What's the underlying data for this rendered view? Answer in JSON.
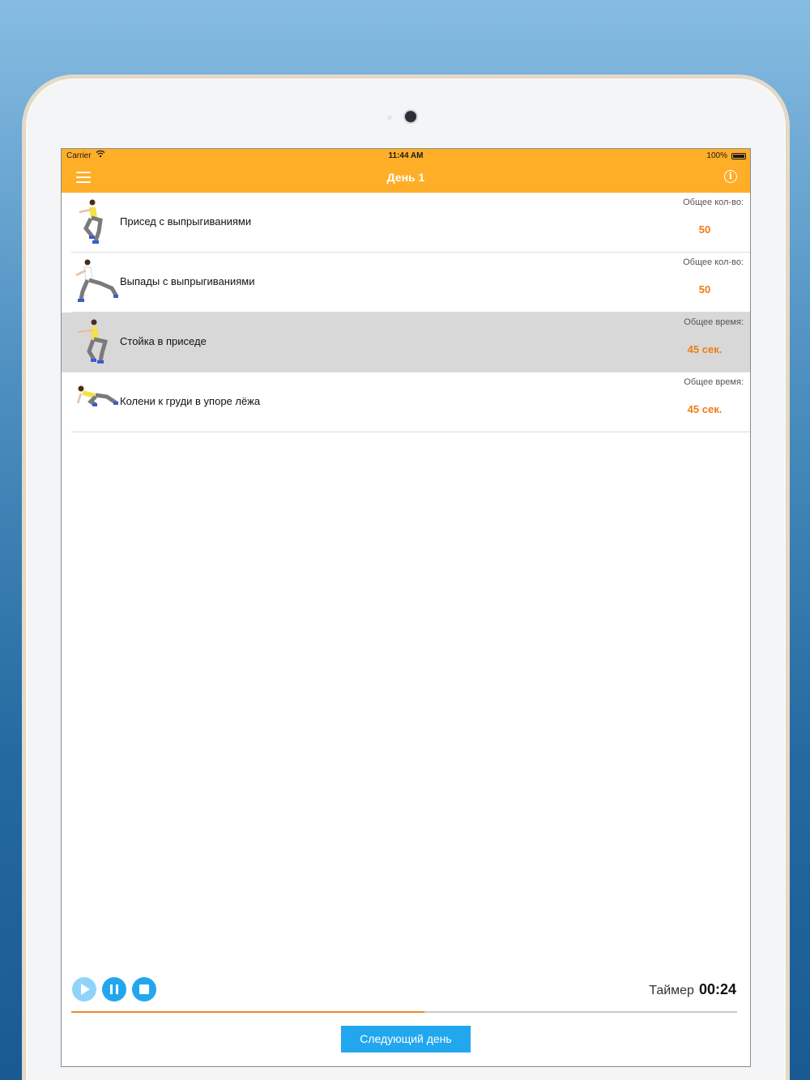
{
  "status_bar": {
    "carrier": "Carrier",
    "time": "11:44 AM",
    "battery": "100%"
  },
  "nav": {
    "title": "День 1"
  },
  "exercises": [
    {
      "name": "Присед с выпрыгиваниями",
      "label": "Общее кол-во:",
      "value": "50",
      "selected": false,
      "pose": "squat-jump"
    },
    {
      "name": "Выпады с выпрыгиваниями",
      "label": "Общее кол-во:",
      "value": "50",
      "selected": false,
      "pose": "lunge"
    },
    {
      "name": "Стойка в приседе",
      "label": "Общее время:",
      "value": "45 сек.",
      "selected": true,
      "pose": "squat-hold"
    },
    {
      "name": "Колени к груди в упоре лёжа",
      "label": "Общее время:",
      "value": "45 сек.",
      "selected": false,
      "pose": "mountain-climber"
    }
  ],
  "timer": {
    "label": "Таймер",
    "value": "00:24",
    "progress": 0.53
  },
  "next_day_button": "Следующий день",
  "colors": {
    "accent": "#ffae28",
    "value_orange": "#f07d10",
    "button_blue": "#22a7ef"
  }
}
